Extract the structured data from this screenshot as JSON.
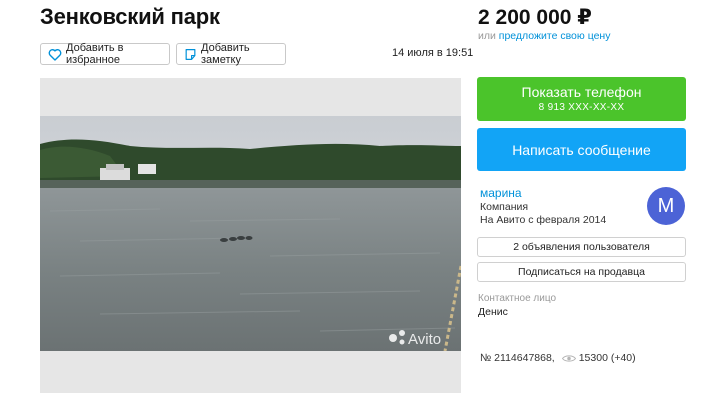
{
  "listing": {
    "title": "Зенковский парк",
    "add_favorite_label": "Добавить в избранное",
    "add_note_label": "Добавить заметку",
    "date": "14 июля в 19:51",
    "photo_watermark": "Avito"
  },
  "sidebar": {
    "price": "2 200 000 ₽",
    "offer_prefix": "или",
    "offer_link": "предложите свою цену",
    "phone_button_label": "Показать телефон",
    "phone_masked": "8 913 XXX-XX-XX",
    "message_button_label": "Написать сообщение",
    "seller": {
      "name": "марина",
      "type": "Компания",
      "since": "На Авито с февраля 2014",
      "avatar_letter": "М"
    },
    "ads_button_label": "2 объявления пользователя",
    "subscribe_button_label": "Подписаться на продавца",
    "contact_label": "Контактное лицо",
    "contact_name": "Денис",
    "ad_number": "№ 2114647868,",
    "views": "15300 (+40)"
  },
  "colors": {
    "green_button": "#4bc42b",
    "blue_button": "#12a4f6",
    "link": "#0091d9",
    "avatar": "#4c63d6"
  },
  "icons": {
    "favorite": "heart-icon",
    "note": "note-icon",
    "views": "eye-icon"
  }
}
